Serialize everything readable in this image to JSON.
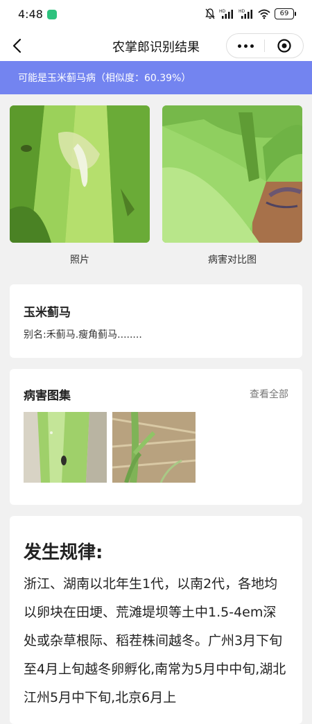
{
  "status_bar": {
    "time": "4:48",
    "battery": "69",
    "signal_1": "HD",
    "signal_2": "HD"
  },
  "nav": {
    "title": "农掌郎识别结果"
  },
  "result": {
    "text": "可能是玉米蓟马病（相似度：60.39%）"
  },
  "photos": {
    "left_caption": "照片",
    "right_caption": "病害对比图"
  },
  "disease": {
    "name": "玉米蓟马",
    "alias": "别名:禾蓟马.瘦角蓟马........"
  },
  "gallery": {
    "title": "病害图集",
    "more": "查看全部"
  },
  "rule": {
    "title": "发生规律:",
    "text": "浙江、湖南以北年生1代，以南2代，各地均以卵块在田埂、荒滩堤坝等土中1.5-4em深处或杂草根际、稻茬株间越冬。广州3月下旬至4月上旬越冬卵孵化,南常为5月中中旬,湖北江州5月中下旬,北京6月上"
  },
  "colors": {
    "banner": "#7384f0",
    "background": "#f1f1f1"
  }
}
